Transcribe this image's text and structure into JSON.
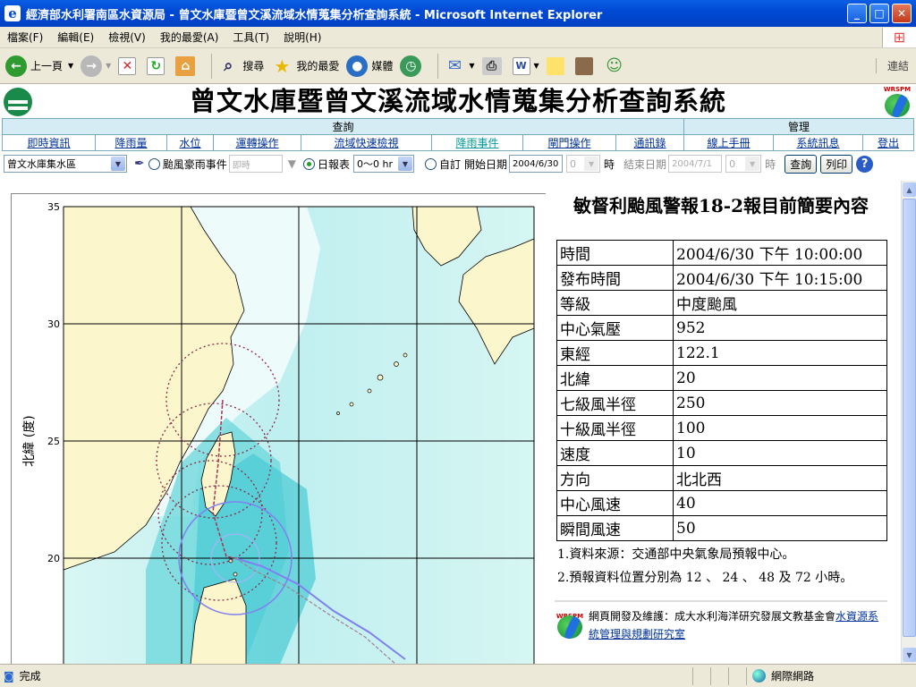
{
  "window": {
    "title": "經濟部水利署南區水資源局 - 曾文水庫暨曾文溪流域水情蒐集分析查詢系統 - Microsoft Internet Explorer"
  },
  "menu": [
    "檔案(F)",
    "編輯(E)",
    "檢視(V)",
    "我的最愛(A)",
    "工具(T)",
    "說明(H)"
  ],
  "toolbar": {
    "back": "上一頁",
    "search": "搜尋",
    "favorites": "我的最愛",
    "media": "媒體",
    "links": "連結"
  },
  "site": {
    "title": "曾文水庫暨曾文溪流域水情蒐集分析查詢系統",
    "logo_text": "WRSPM"
  },
  "nav": {
    "group_query": "查詢",
    "group_manage": "管理",
    "items": [
      "即時資訊",
      "降雨量",
      "水位",
      "運轉操作",
      "流域快速檢視",
      "降雨事件",
      "閘門操作",
      "通訊錄",
      "線上手冊",
      "系統訊息",
      "登出"
    ]
  },
  "query": {
    "area_select": "曾文水庫集水區",
    "typhoon_label": "颱風豪雨事件",
    "typhoon_value": "即時",
    "daily_label": "日報表",
    "daily_range": "0～0 hr",
    "custom_label": "自訂",
    "start_label": "開始日期",
    "start_date": "2004/6/30",
    "start_hour": "0",
    "hour_unit": "時",
    "end_label": "結束日期",
    "end_date": "2004/7/1",
    "end_hour": "0",
    "end_hour_unit": "時",
    "query_button": "查詢",
    "print_button": "列印",
    "help_icon": "?"
  },
  "map": {
    "lat_axis_label": "北緯 (度)",
    "lat_ticks": [
      "35",
      "30",
      "25",
      "20"
    ],
    "colors": {
      "land": "#fbf6cc",
      "sea_light": "#eefbfb",
      "sea_mid": "#b4ecec",
      "sea_deep": "#5fd6dc",
      "track": "#8080f0",
      "circle": "#8a2a4a"
    }
  },
  "report": {
    "heading": "敏督利颱風警報18-2報目前簡要內容",
    "rows": [
      {
        "k": "時間",
        "v": "2004/6/30 下午 10:00:00"
      },
      {
        "k": "發布時間",
        "v": "2004/6/30 下午 10:15:00"
      },
      {
        "k": "等級",
        "v": "中度颱風"
      },
      {
        "k": "中心氣壓",
        "v": "952"
      },
      {
        "k": "東經",
        "v": "122.1"
      },
      {
        "k": "北緯",
        "v": "20"
      },
      {
        "k": "七級風半徑",
        "v": "250"
      },
      {
        "k": "十級風半徑",
        "v": "100"
      },
      {
        "k": "速度",
        "v": "10"
      },
      {
        "k": "方向",
        "v": "北北西"
      },
      {
        "k": "中心風速",
        "v": "40"
      },
      {
        "k": "瞬間風速",
        "v": "50"
      }
    ],
    "note1": "1.資料來源：交通部中央氣象局預報中心。",
    "note2": "2.預報資料位置分別為 12 、 24 、 48 及 72 小時。",
    "footer_text": "網頁開發及維護：成大水利海洋研究發展文教基金會",
    "footer_link": "水資源系統管理與規劃研究室",
    "footer_logo": "WRSPM"
  },
  "status": {
    "left": "完成",
    "zone": "網際網路"
  }
}
